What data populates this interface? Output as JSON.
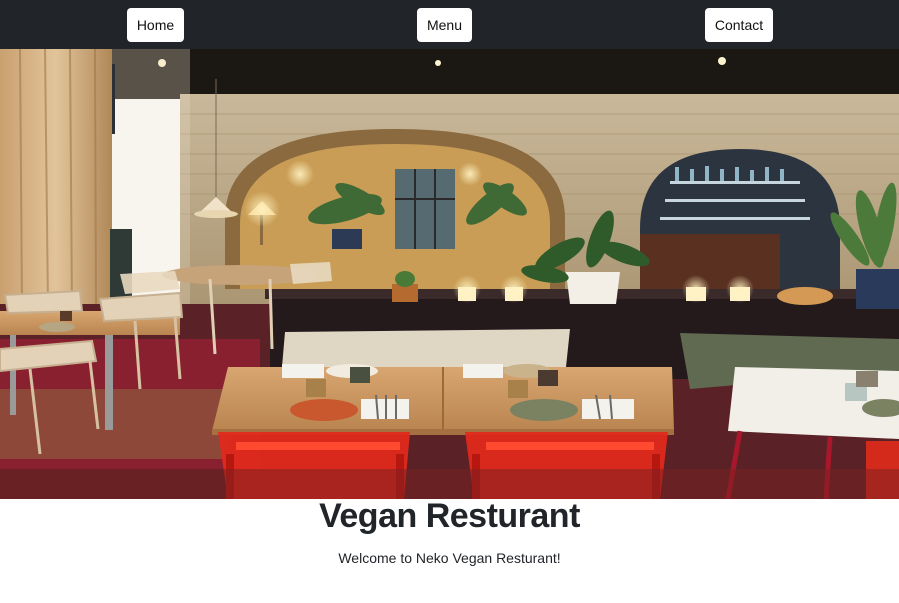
{
  "nav": {
    "home_label": "Home",
    "menu_label": "Menu",
    "contact_label": "Contact"
  },
  "hero": {
    "image": "restaurant-interior-photo"
  },
  "main": {
    "title": "Vegan Resturant",
    "subtitle": "Welcome to Neko Vegan Resturant!"
  },
  "colors": {
    "navbar": "#212429",
    "button": "#ffffff",
    "text": "#212529"
  }
}
